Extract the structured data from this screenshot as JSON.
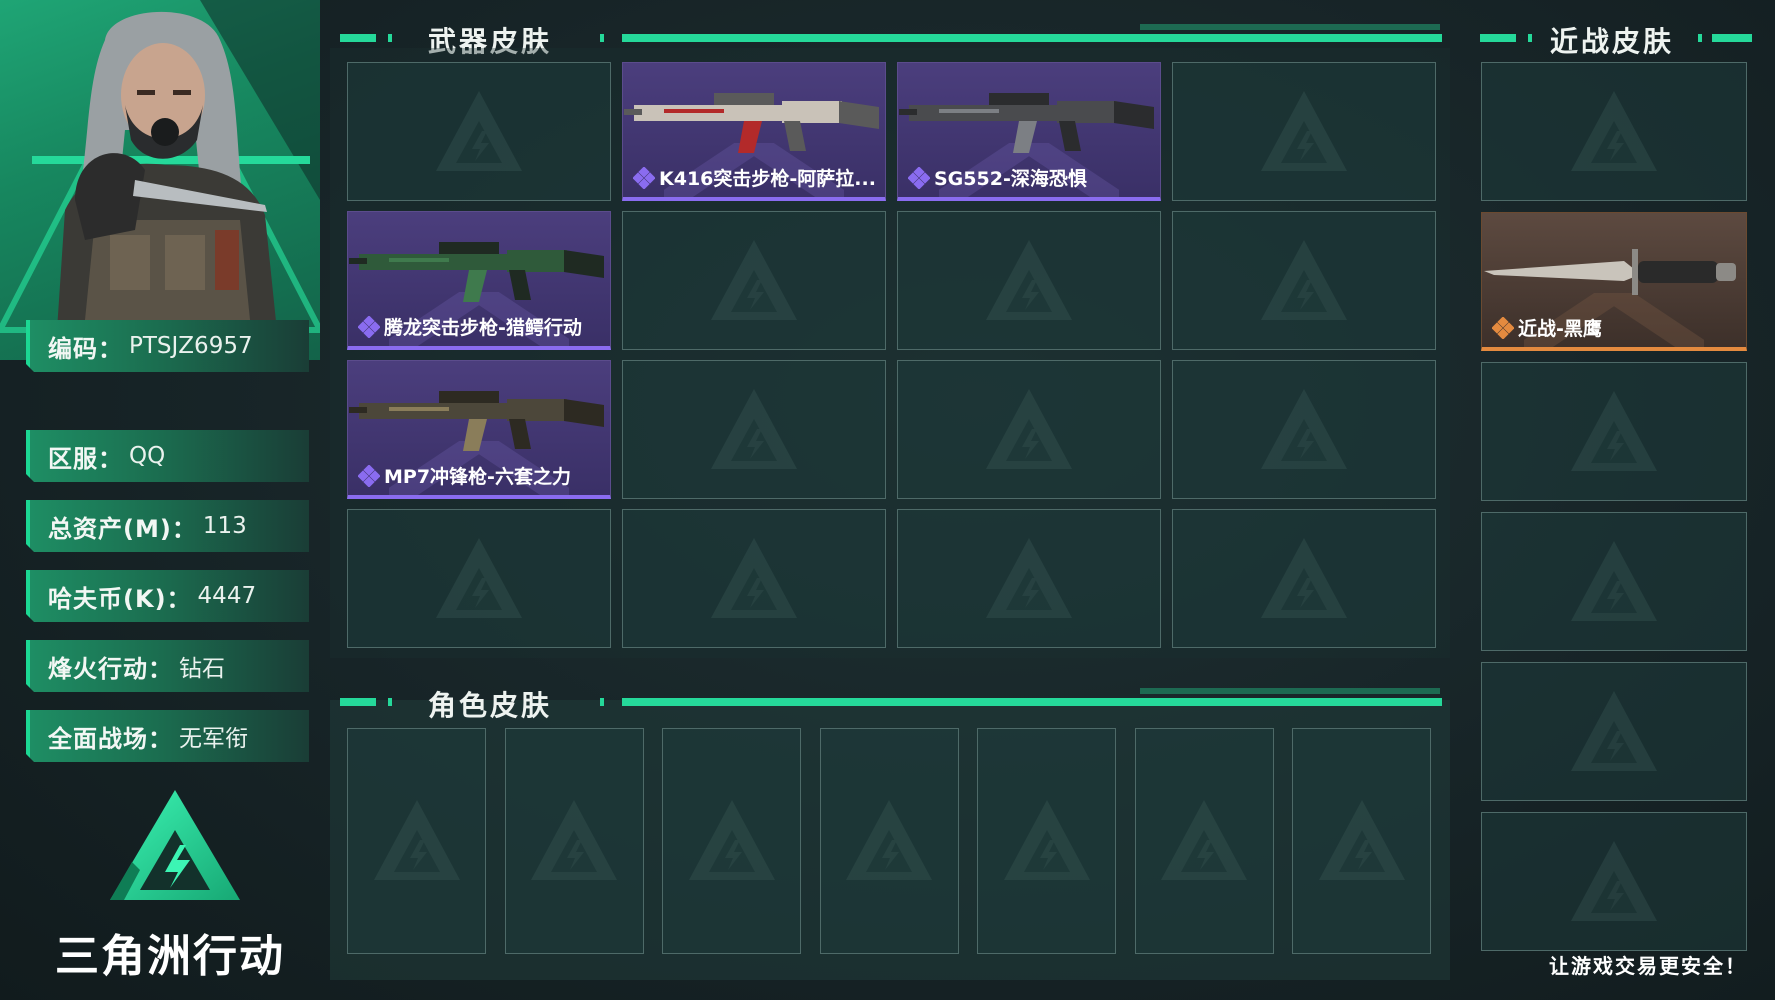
{
  "profile": {
    "rows": [
      {
        "label": "编码：",
        "value": "PTSJZ6957"
      },
      {
        "label": "区服：",
        "value": "QQ"
      },
      {
        "label": "总资产(M)：",
        "value": "113"
      },
      {
        "label": "哈夫币(K)：",
        "value": "4447"
      },
      {
        "label": "烽火行动：",
        "value": "钻石"
      },
      {
        "label": "全面战场：",
        "value": "无军衔"
      }
    ]
  },
  "brand": {
    "name": "三角洲行动"
  },
  "sections": {
    "weapon_skins": "武器皮肤",
    "melee_skins": "近战皮肤",
    "role_skins": "角色皮肤"
  },
  "weapon_grid": [
    {
      "label": ""
    },
    {
      "label": "K416突击步枪-阿萨拉...",
      "rarity": "purple"
    },
    {
      "label": "SG552-深海恐惧",
      "rarity": "purple"
    },
    {
      "label": ""
    },
    {
      "label": "腾龙突击步枪-猎鳄行动",
      "rarity": "purple"
    },
    {
      "label": ""
    },
    {
      "label": ""
    },
    {
      "label": ""
    },
    {
      "label": "MP7冲锋枪-六套之力",
      "rarity": "purple"
    },
    {
      "label": ""
    },
    {
      "label": ""
    },
    {
      "label": ""
    },
    {
      "label": ""
    },
    {
      "label": ""
    },
    {
      "label": ""
    },
    {
      "label": ""
    }
  ],
  "melee_list": [
    {
      "label": ""
    },
    {
      "label": "近战-黑鹰",
      "rarity": "orange"
    },
    {
      "label": ""
    },
    {
      "label": ""
    },
    {
      "label": ""
    },
    {
      "label": ""
    }
  ],
  "role_slots": 7,
  "footer": {
    "slogan": "让游戏交易更安全！"
  },
  "colors": {
    "accent": "#25d99a",
    "purple_rarity": "#8a6cf0",
    "orange_rarity": "#e48a3f"
  }
}
